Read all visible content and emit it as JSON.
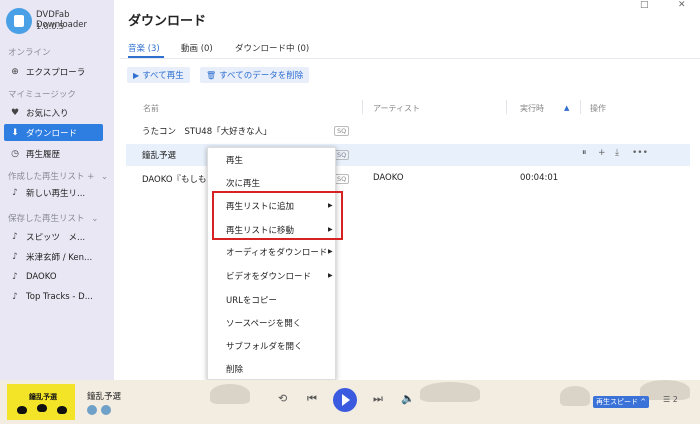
{
  "app": {
    "name": "DVDFab Downloader",
    "version": "1.0.0.5"
  },
  "window_controls": {
    "restore": "□",
    "close": "✕"
  },
  "sidebar": {
    "online_label": "オンライン",
    "explorer": "エクスプローラ",
    "my_music_label": "マイミュージック",
    "favorites": "お気に入り",
    "downloads": "ダウンロード",
    "history": "再生履歴",
    "created_playlists_label": "作成した再生リスト",
    "created_add": "+",
    "created_arrow": "⌄",
    "new_playlist": "新しい再生リ...",
    "saved_playlists_label": "保存した再生リスト",
    "saved_arrow": "⌄",
    "saved_items": [
      "スピッツ　メ...",
      "米津玄師 / Ken...",
      "DAOKO",
      "Top Tracks - D..."
    ]
  },
  "main": {
    "title": "ダウンロード",
    "tabs": [
      {
        "label": "音楽 (3)"
      },
      {
        "label": "動画 (0)"
      },
      {
        "label": "ダウンロード中 (0)"
      }
    ],
    "play_all": "すべて再生",
    "delete_all": "すべてのデータを削除"
  },
  "table": {
    "headers": {
      "name": "名前",
      "artist": "アーティスト",
      "duration": "実行時",
      "sort": "▲",
      "actions": "操作"
    },
    "rows": [
      {
        "name": "うたコン　STU48「大好きな人」",
        "badge": "SQ",
        "artist": "",
        "duration": ""
      },
      {
        "name": "鐘乱予選",
        "badge": "SQ",
        "artist": "",
        "duration": ""
      },
      {
        "name": "DAOKO『もしも",
        "badge": "SQ",
        "artist": "DAOKO",
        "duration": "00:04:01"
      }
    ],
    "row_actions": [
      "⏸",
      "+",
      "⤓",
      "•••"
    ]
  },
  "context_menu": {
    "items": [
      {
        "label": "再生"
      },
      {
        "label": "次に再生"
      },
      {
        "label": "再生リストに追加",
        "sub": "▶"
      },
      {
        "label": "再生リストに移動",
        "sub": "▶"
      },
      {
        "label": "オーディオをダウンロード",
        "sub": "▶"
      },
      {
        "label": "ビデオをダウンロード",
        "sub": "▶"
      },
      {
        "label": "URLをコピー"
      },
      {
        "label": "ソースページを開く"
      },
      {
        "label": "サブフォルダを開く"
      },
      {
        "label": "削除"
      }
    ]
  },
  "player": {
    "art_text": "鐘乱予選",
    "song_title": "鐘乱予選",
    "speed_label": "再生スピード ^",
    "queue_count": "2"
  },
  "colors": {
    "accent": "#2e7de0",
    "sidebar_bg": "#eae7f4",
    "highlight_box": "#d62222",
    "play_button": "#3a5be0"
  }
}
